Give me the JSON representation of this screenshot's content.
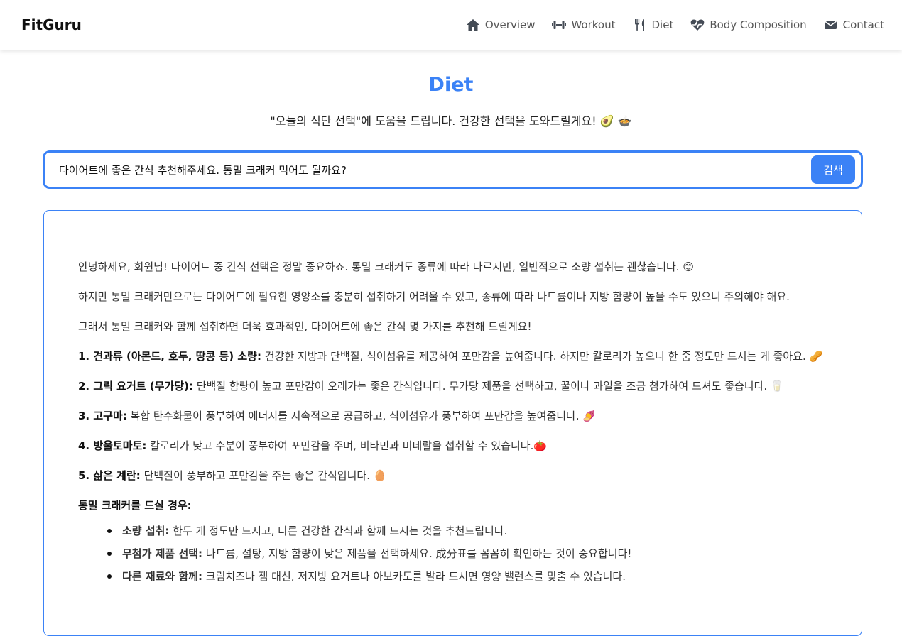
{
  "brand": "FitGuru",
  "nav": [
    {
      "label": "Overview",
      "icon": "home-icon"
    },
    {
      "label": "Workout",
      "icon": "dumbbell-icon"
    },
    {
      "label": "Diet",
      "icon": "utensils-icon"
    },
    {
      "label": "Body Composition",
      "icon": "heartbeat-icon"
    },
    {
      "label": "Contact",
      "icon": "envelope-icon"
    }
  ],
  "page": {
    "title": "Diet",
    "subtitle": "\"오늘의 식단 선택\"에 도움을 드립니다. 건강한 선택을 도와드릴게요! 🥑 🍲"
  },
  "search": {
    "value": "다이어트에 좋은 간식 추천해주세요. 통밀 크래커 먹어도 될까요?",
    "button_label": "검색"
  },
  "answer": {
    "paragraphs": [
      "안녕하세요, 회원님! 다이어트 중 간식 선택은 정말 중요하죠. 통밀 크래커도 종류에 따라 다르지만, 일반적으로 소량 섭취는 괜찮습니다. 😊",
      "하지만 통밀 크래커만으로는 다이어트에 필요한 영양소를 충분히 섭취하기 어려울 수 있고, 종류에 따라 나트륨이나 지방 함량이 높을 수도 있으니 주의해야 해요.",
      "그래서 통밀 크래커와 함께 섭취하면 더욱 효과적인, 다이어트에 좋은 간식 몇 가지를 추천해 드릴게요!"
    ],
    "recommendations": [
      {
        "title": "1. 견과류 (아몬드, 호두, 땅콩 등) 소량:",
        "text": "건강한 지방과 단백질, 식이섬유를 제공하여 포만감을 높여줍니다. 하지만 칼로리가 높으니 한 줌 정도만 드시는 게 좋아요. 🥜"
      },
      {
        "title": "2. 그릭 요거트 (무가당):",
        "text": "단백질 함량이 높고 포만감이 오래가는 좋은 간식입니다. 무가당 제품을 선택하고, 꿀이나 과일을 조금 첨가하여 드셔도 좋습니다. 🥛"
      },
      {
        "title": "3. 고구마:",
        "text": "복합 탄수화물이 풍부하여 에너지를 지속적으로 공급하고, 식이섬유가 풍부하여 포만감을 높여줍니다. 🍠"
      },
      {
        "title": "4. 방울토마토:",
        "text": "칼로리가 낮고 수분이 풍부하여 포만감을 주며, 비타민과 미네랄을 섭취할 수 있습니다.🍅"
      },
      {
        "title": "5. 삶은 계란:",
        "text": "단백질이 풍부하고 포만감을 주는 좋은 간식입니다. 🥚"
      }
    ],
    "cracker_heading": "통밀 크래커를 드실 경우:",
    "cracker_tips": [
      {
        "title": "소량 섭취:",
        "text": "한두 개 정도만 드시고, 다른 건강한 간식과 함께 드시는 것을 추천드립니다."
      },
      {
        "title": "무첨가 제품 선택:",
        "text": "나트륨, 설탕, 지방 함량이 낮은 제품을 선택하세요. 成分표를 꼼꼼히 확인하는 것이 중요합니다!"
      },
      {
        "title": "다른 재료와 함께:",
        "text": "크림치즈나 잼 대신, 저지방 요거트나 아보카도를 발라 드시면 영양 밸런스를 맞출 수 있습니다."
      }
    ]
  },
  "colors": {
    "accent": "#3b82f6"
  }
}
